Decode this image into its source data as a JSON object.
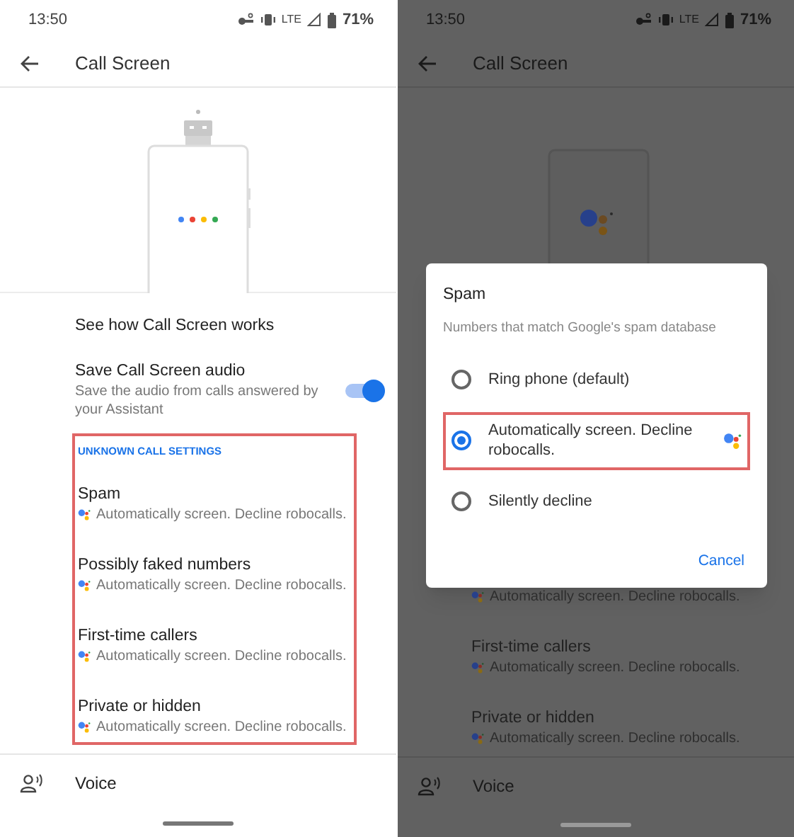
{
  "left_screen": {
    "status_bar": {
      "time": "13:50",
      "network": "LTE",
      "battery": "71%"
    },
    "app_bar": {
      "title": "Call Screen"
    },
    "items": [
      {
        "kind": "link",
        "title": "See how Call Screen works"
      },
      {
        "kind": "toggle",
        "title": "Save Call Screen audio",
        "subtitle": "Save the audio from calls answered by your Assistant",
        "on": true
      }
    ],
    "section": {
      "header": "UNKNOWN CALL SETTINGS",
      "highlighted": true,
      "rows": [
        {
          "title": "Spam",
          "subtitle": "Automatically screen. Decline robocalls."
        },
        {
          "title": "Possibly faked numbers",
          "subtitle": "Automatically screen. Decline robocalls."
        },
        {
          "title": "First-time callers",
          "subtitle": "Automatically screen. Decline robocalls."
        },
        {
          "title": "Private or hidden",
          "subtitle": "Automatically screen. Decline robocalls."
        }
      ]
    },
    "footer_item": {
      "title": "Voice"
    }
  },
  "right_screen": {
    "status_bar": {
      "time": "13:50",
      "network": "LTE",
      "battery": "71%"
    },
    "app_bar": {
      "title": "Call Screen"
    },
    "dialog": {
      "title": "Spam",
      "subtitle": "Numbers that match Google's spam database",
      "options": [
        {
          "label": "Ring phone (default)",
          "selected": false,
          "highlighted": false,
          "assistant": false
        },
        {
          "label": "Automatically screen. Decline robocalls.",
          "selected": true,
          "highlighted": true,
          "assistant": true
        },
        {
          "label": "Silently decline",
          "selected": false,
          "highlighted": false,
          "assistant": false
        }
      ],
      "button": "Cancel"
    },
    "rows": [
      {
        "subtitle": "Automatically screen. Decline robocalls."
      },
      {
        "title": "First-time callers",
        "subtitle": "Automatically screen. Decline robocalls."
      },
      {
        "title": "Private or hidden",
        "subtitle": "Automatically screen. Decline robocalls."
      }
    ],
    "footer_item": {
      "title": "Voice"
    }
  }
}
